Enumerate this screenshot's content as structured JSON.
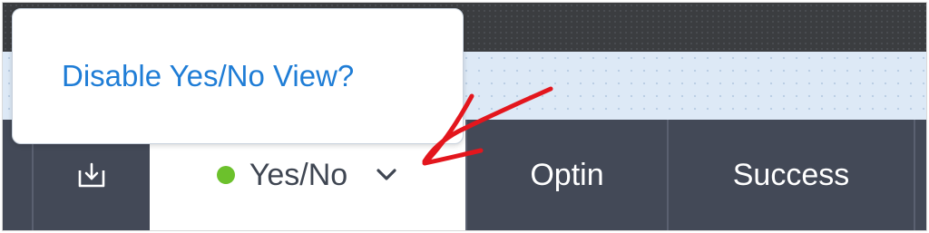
{
  "popover": {
    "link_text": "Disable Yes/No View?"
  },
  "tabs": {
    "yesno_label": "Yes/No",
    "optin_label": "Optin",
    "success_label": "Success"
  },
  "icons": {
    "export": "export-download-icon",
    "dropdown": "chevron-down-icon",
    "status": "green-dot"
  },
  "colors": {
    "active_dot": "#6cc12c",
    "link": "#1f7dd6",
    "annotation_arrow": "#e3161d",
    "tab_bar": "#434957"
  }
}
